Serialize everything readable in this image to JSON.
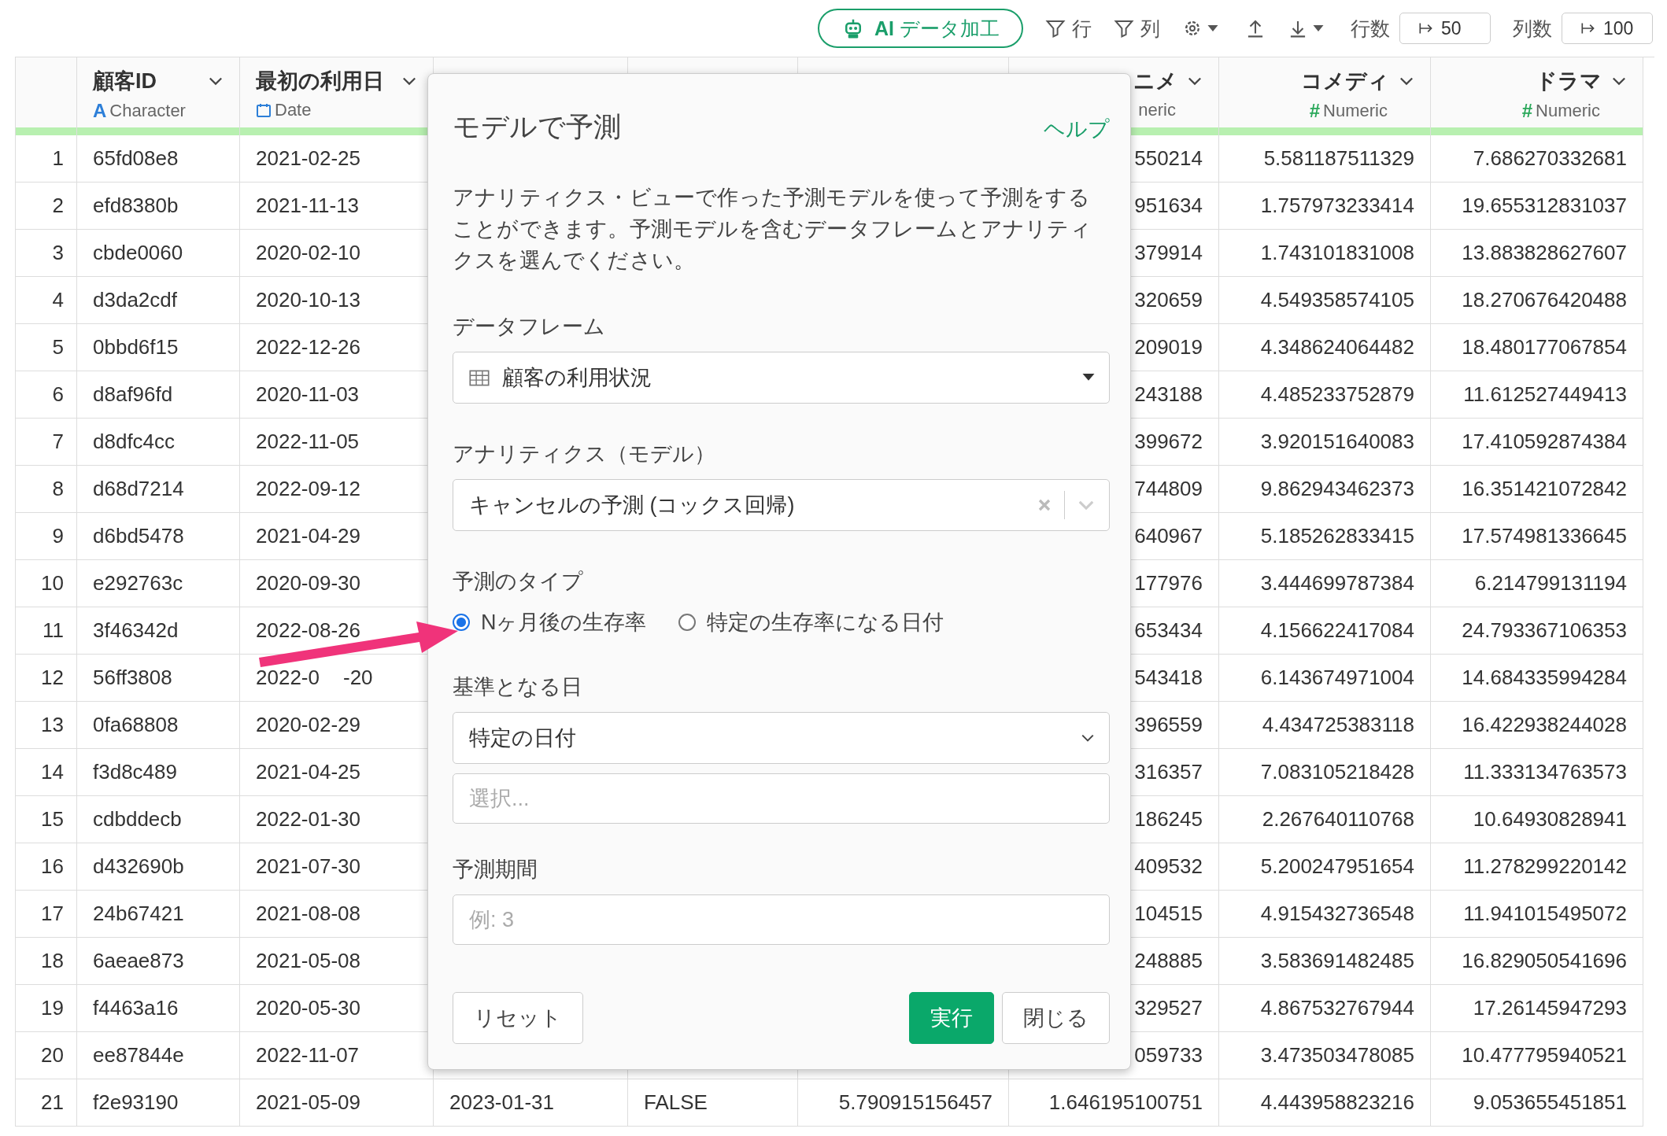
{
  "toolbar": {
    "ai_button": "**AI** データ加工",
    "row_filter": "行",
    "column_filter": "列",
    "row_count_label": "行数",
    "row_count": "50",
    "column_count_label": "列数",
    "column_count": "100"
  },
  "table": {
    "columns": [
      {
        "title": "顧客ID",
        "type": "Character",
        "kind": "character",
        "type_icon": "A"
      },
      {
        "title": "最初の利用日",
        "type": "Date",
        "kind": "date"
      },
      null,
      null,
      null,
      {
        "title": "ニメ",
        "type": "neric",
        "kind": "numeric"
      },
      {
        "title": "コメディ",
        "type": "Numeric",
        "kind": "numeric",
        "type_icon": "#"
      },
      {
        "title": "ドラマ",
        "type": "Numeric",
        "kind": "numeric",
        "type_icon": "#"
      }
    ],
    "rows": [
      {
        "number": "1",
        "cells": [
          "65fd08e8",
          "2021-02-25",
          null,
          null,
          null,
          "550214",
          "5.581187511329",
          "7.686270332681"
        ]
      },
      {
        "number": "2",
        "cells": [
          "efd8380b",
          "2021-11-13",
          null,
          null,
          null,
          "951634",
          "1.757973233414",
          "19.655312831037"
        ]
      },
      {
        "number": "3",
        "cells": [
          "cbde0060",
          "2020-02-10",
          null,
          null,
          null,
          "379914",
          "1.743101831008",
          "13.883828627607"
        ]
      },
      {
        "number": "4",
        "cells": [
          "d3da2cdf",
          "2020-10-13",
          null,
          null,
          null,
          "320659",
          "4.549358574105",
          "18.270676420488"
        ]
      },
      {
        "number": "5",
        "cells": [
          "0bbd6f15",
          "2022-12-26",
          null,
          null,
          null,
          "209019",
          "4.348624064482",
          "18.480177067854"
        ]
      },
      {
        "number": "6",
        "cells": [
          "d8af96fd",
          "2020-11-03",
          null,
          null,
          null,
          "243188",
          "4.485233752879",
          "11.612527449413"
        ]
      },
      {
        "number": "7",
        "cells": [
          "d8dfc4cc",
          "2022-11-05",
          null,
          null,
          null,
          "399672",
          "3.920151640083",
          "17.410592874384"
        ]
      },
      {
        "number": "8",
        "cells": [
          "d68d7214",
          "2022-09-12",
          null,
          null,
          null,
          "744809",
          "9.862943462373",
          "16.351421072842"
        ]
      },
      {
        "number": "9",
        "cells": [
          "d6bd5478",
          "2021-04-29",
          null,
          null,
          null,
          "640967",
          "5.185262833415",
          "17.574981336645"
        ]
      },
      {
        "number": "10",
        "cells": [
          "e292763c",
          "2020-09-30",
          null,
          null,
          null,
          "177976",
          "3.444699787384",
          "6.214799131194"
        ]
      },
      {
        "number": "11",
        "cells": [
          "3f46342d",
          "2022-08-26",
          null,
          null,
          null,
          "653434",
          "4.156622417084",
          "24.793367106353"
        ]
      },
      {
        "number": "12",
        "cells": [
          "56ff3808",
          {
            "parts": [
              "2022-0",
              "-20"
            ]
          },
          null,
          null,
          null,
          "543418",
          "6.143674971004",
          "14.684335994284"
        ]
      },
      {
        "number": "13",
        "cells": [
          "0fa68808",
          "2020-02-29",
          null,
          null,
          null,
          "396559",
          "4.434725383118",
          "16.422938244028"
        ]
      },
      {
        "number": "14",
        "cells": [
          "f3d8c489",
          "2021-04-25",
          null,
          null,
          null,
          "316357",
          "7.083105218428",
          "11.333134763573"
        ]
      },
      {
        "number": "15",
        "cells": [
          "cdbddecb",
          "2022-01-30",
          null,
          null,
          null,
          "186245",
          "2.267640110768",
          "10.64930828941"
        ]
      },
      {
        "number": "16",
        "cells": [
          "d432690b",
          "2021-07-30",
          null,
          null,
          null,
          "409532",
          "5.200247951654",
          "11.278299220142"
        ]
      },
      {
        "number": "17",
        "cells": [
          "24b67421",
          "2021-08-08",
          null,
          null,
          null,
          "104515",
          "4.915432736548",
          "11.941015495072"
        ]
      },
      {
        "number": "18",
        "cells": [
          "6aeae873",
          "2021-05-08",
          null,
          null,
          null,
          "248885",
          "3.583691482485",
          "16.829050541696"
        ]
      },
      {
        "number": "19",
        "cells": [
          "f4463a16",
          "2020-05-30",
          null,
          null,
          null,
          "329527",
          "4.867532767944",
          "17.26145947293"
        ]
      },
      {
        "number": "20",
        "cells": [
          "ee87844e",
          "2022-11-07",
          null,
          null,
          null,
          "059733",
          "3.473503478085",
          "10.477795940521"
        ]
      },
      {
        "number": "21",
        "cells": [
          "f2e93190",
          "2021-05-09",
          "2023-01-31",
          "FALSE",
          "5.790915156457",
          "1.646195100751",
          "4.443958823216",
          "9.053655451851"
        ]
      }
    ]
  },
  "dialog": {
    "title": "モデルで予測",
    "help_link": "ヘルプ",
    "description": "アナリティクス・ビューで作った予測モデルを使って予測をすることができます。予測モデルを含むデータフレームとアナリティクスを選んでください。",
    "dataframe": {
      "label": "データフレーム",
      "value": "顧客の利用状況"
    },
    "analytics": {
      "label": "アナリティクス（モデル）",
      "value": "キャンセルの予測 (コックス回帰)"
    },
    "prediction_type": {
      "label": "予測のタイプ",
      "options": [
        {
          "label": "Nヶ月後の生存率",
          "selected": true
        },
        {
          "label": "特定の生存率になる日付",
          "selected": false
        }
      ]
    },
    "base_date": {
      "label": "基準となる日",
      "value": "特定の日付",
      "date_placeholder": "選択..."
    },
    "period": {
      "label": "予測期間",
      "placeholder": "例: 3"
    },
    "buttons": {
      "reset": "リセット",
      "run": "実行",
      "close": "閉じる"
    }
  }
}
